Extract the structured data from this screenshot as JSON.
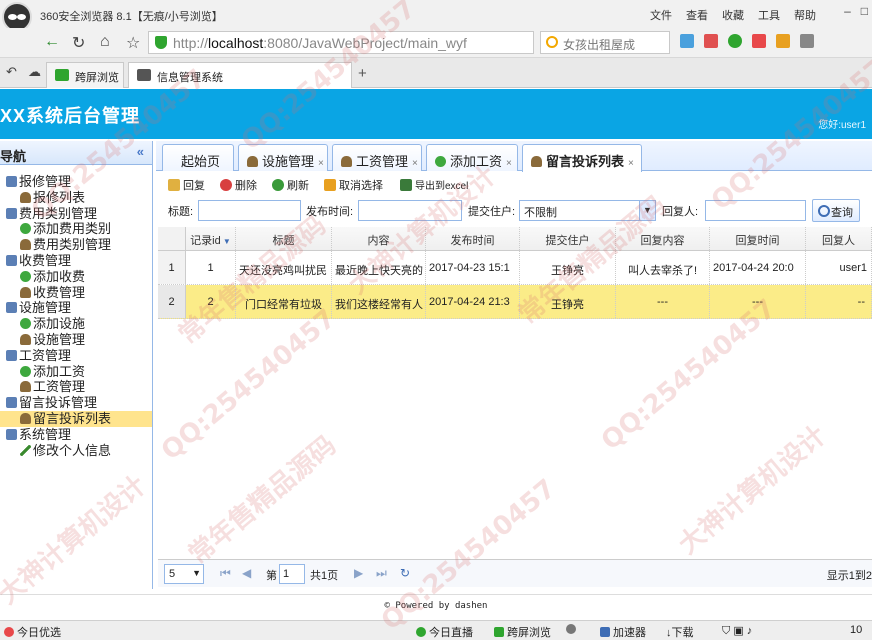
{
  "browser": {
    "title": "360安全浏览器 8.1【无痕/小号浏览】",
    "menu": [
      "文件",
      "查看",
      "收藏",
      "工具",
      "帮助"
    ],
    "url_prefix": "http://",
    "url_host": "localhost",
    "url_rest": ":8080/JavaWebProject/main_wyf",
    "search_placeholder": "女孩出租屋成",
    "tabs": [
      "跨屏浏览",
      "信息管理系统"
    ],
    "new_tab": "+",
    "status_left": "今日优选",
    "status_items": [
      "今日直播",
      "跨屏浏览",
      "加速器",
      "下载",
      "10"
    ]
  },
  "app": {
    "title": "XX系统后台管理",
    "welcome_label": "您好:",
    "welcome_user": "user1",
    "footer": "© Powered by dashen"
  },
  "sidebar": {
    "title": "导航",
    "collapse": "«",
    "nodes": [
      {
        "label": "报修管理",
        "type": "parent"
      },
      {
        "label": "报修列表",
        "type": "child"
      },
      {
        "label": "费用类别管理",
        "type": "parent"
      },
      {
        "label": "添加费用类别",
        "type": "child"
      },
      {
        "label": "费用类别管理",
        "type": "child"
      },
      {
        "label": "收费管理",
        "type": "parent"
      },
      {
        "label": "添加收费",
        "type": "child"
      },
      {
        "label": "收费管理",
        "type": "child"
      },
      {
        "label": "设施管理",
        "type": "parent"
      },
      {
        "label": "添加设施",
        "type": "child"
      },
      {
        "label": "设施管理",
        "type": "child"
      },
      {
        "label": "工资管理",
        "type": "parent"
      },
      {
        "label": "添加工资",
        "type": "child"
      },
      {
        "label": "工资管理",
        "type": "child"
      },
      {
        "label": "留言投诉管理",
        "type": "parent"
      },
      {
        "label": "留言投诉列表",
        "type": "child",
        "selected": true
      },
      {
        "label": "系统管理",
        "type": "parent"
      },
      {
        "label": "修改个人信息",
        "type": "child"
      }
    ]
  },
  "panel_tabs": [
    "起始页",
    "设施管理",
    "工资管理",
    "添加工资",
    "留言投诉列表"
  ],
  "toolbar": [
    "回复",
    "删除",
    "刷新",
    "取消选择",
    "导出到excel"
  ],
  "filters": {
    "title_label": "标题:",
    "time_label": "发布时间:",
    "resident_label": "提交住户:",
    "resident_value": "不限制",
    "replier_label": "回复人:",
    "query_button": "查询"
  },
  "table": {
    "columns": [
      "记录id",
      "标题",
      "内容",
      "发布时间",
      "提交住户",
      "回复内容",
      "回复时间",
      "回复人"
    ],
    "rows": [
      {
        "num": "1",
        "id": "1",
        "title": "天还没亮鸡叫扰民",
        "content": "最近晚上快天亮的",
        "time": "2017-04-23 15:1",
        "resident": "王铮亮",
        "reply": "叫人去宰杀了!",
        "reply_time": "2017-04-24 20:0",
        "replier": "user1"
      },
      {
        "num": "2",
        "id": "2",
        "title": "门口经常有垃圾",
        "content": "我们这楼经常有人",
        "time": "2017-04-24 21:3",
        "resident": "王铮亮",
        "reply": "---",
        "reply_time": "---",
        "replier": "--"
      }
    ]
  },
  "pager": {
    "page_size": "5",
    "page_prefix": "第",
    "page_value": "1",
    "page_total": "共1页",
    "info": "显示1到2"
  },
  "watermarks": [
    "QQ:254540457",
    "大神计算机设计",
    "常年售精品源码"
  ],
  "colors": {
    "header": "#0aa5e4",
    "selected_row": "#fbec88",
    "border": "#95b8e7"
  }
}
